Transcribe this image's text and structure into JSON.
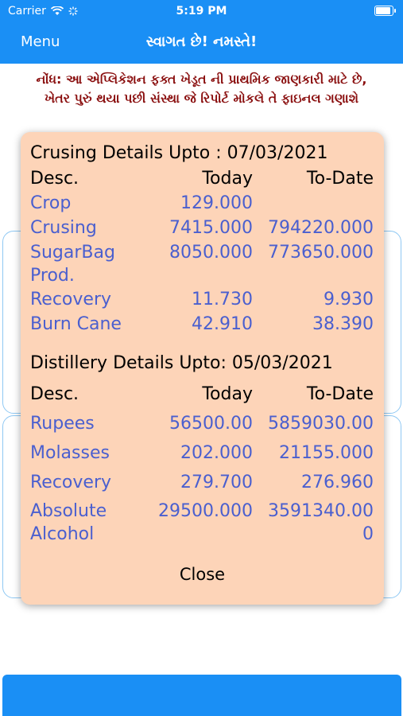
{
  "status": {
    "carrier": "Carrier",
    "time": "5:19 PM"
  },
  "nav": {
    "menu": "Menu",
    "title": "સ્વાગત છે! નમસ્તે!"
  },
  "note": {
    "line1": "નોંધ: આ એપ્લિકેશન ફક્ત ખેડૂત ની પ્રાથમિક જાણકારી માટે છે,",
    "line2": "ખેતર પુરું થયા પછી સંસ્થા જે રિપોર્ટ મોકલે તે ફાઇનલ ગણાશે"
  },
  "crusing": {
    "title": "Crusing Details Upto : 07/03/2021",
    "headers": {
      "desc": "Desc.",
      "today": "Today",
      "todate": "To-Date"
    },
    "rows": [
      {
        "desc": "Crop",
        "today": "129.000",
        "todate": ""
      },
      {
        "desc": "Crusing",
        "today": "7415.000",
        "todate": "794220.000"
      },
      {
        "desc": "SugarBag",
        "today": "8050.000",
        "todate": "773650.000"
      },
      {
        "desc": "Prod.",
        "today": "",
        "todate": ""
      },
      {
        "desc": "Recovery",
        "today": "11.730",
        "todate": "9.930"
      },
      {
        "desc": "Burn Cane",
        "today": "42.910",
        "todate": "38.390"
      }
    ]
  },
  "distillery": {
    "title": "Distillery Details Upto: 05/03/2021",
    "headers": {
      "desc": "Desc.",
      "today": "Today",
      "todate": "To-Date"
    },
    "rows": [
      {
        "desc": "Rupees",
        "today": "56500.00",
        "todate": "5859030.00"
      },
      {
        "desc": "Molasses",
        "today": "202.000",
        "todate": "21155.000"
      },
      {
        "desc": "Recovery",
        "today": "279.700",
        "todate": "276.960"
      },
      {
        "desc": "Absolute",
        "today": "29500.000",
        "todate": "3591340.00"
      },
      {
        "desc": "Alcohol",
        "today": "",
        "todate": "0"
      }
    ]
  },
  "close": "Close"
}
